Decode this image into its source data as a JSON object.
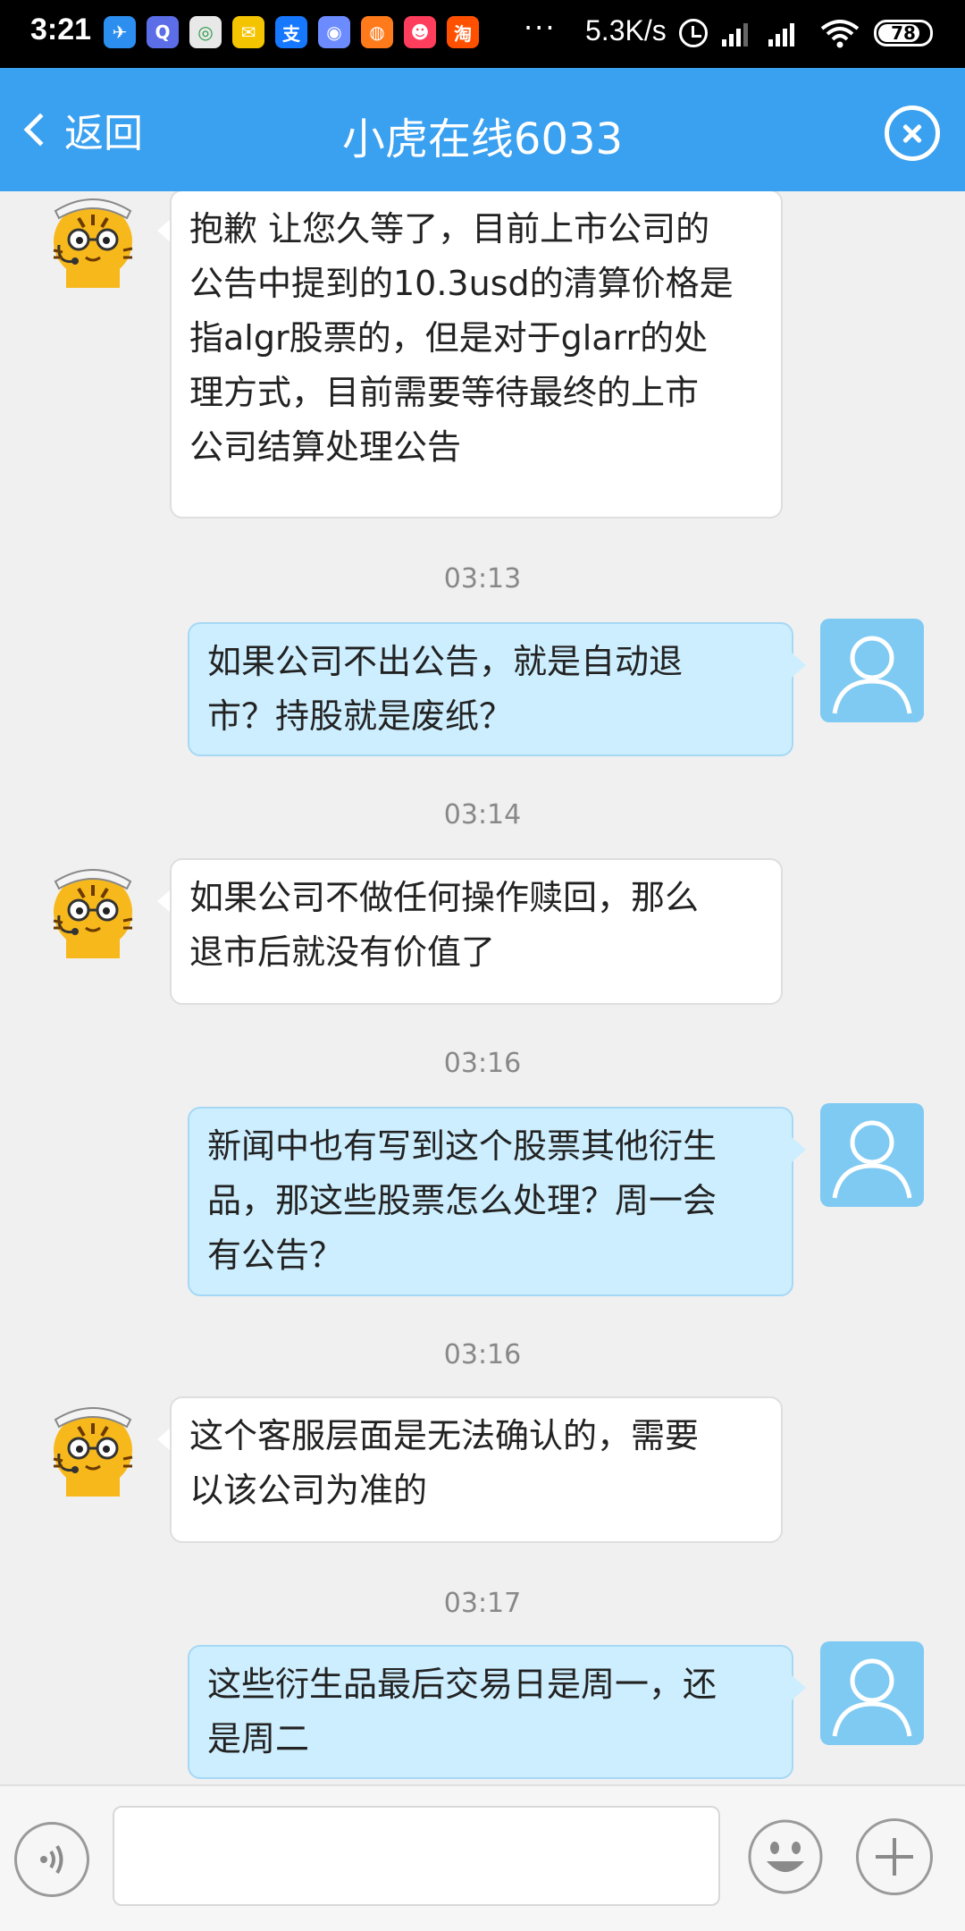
{
  "status_bar": {
    "time": "3:21",
    "network_speed": "5.3K/s",
    "battery": "78",
    "dots": "···",
    "app_icons": [
      {
        "name": "telegram-app-icon",
        "glyph": "✈",
        "color": "#2c8ff0"
      },
      {
        "name": "browser-app-icon",
        "glyph": "Q",
        "color": "#5b6ee8"
      },
      {
        "name": "chrome-app-icon",
        "glyph": "◎",
        "color": "#e8e8e8"
      },
      {
        "name": "mail-app-icon",
        "glyph": "✉",
        "color": "#f5c400"
      },
      {
        "name": "alipay-app-icon",
        "glyph": "支",
        "color": "#1677ff"
      },
      {
        "name": "chat-app-icon",
        "glyph": "◉",
        "color": "#6b8bff"
      },
      {
        "name": "weibo-app-icon",
        "glyph": "◍",
        "color": "#ff7a1a"
      },
      {
        "name": "pinduoduo-app-icon",
        "glyph": "☻",
        "color": "#ff3d5c"
      },
      {
        "name": "taobao-app-icon",
        "glyph": "淘",
        "color": "#ff5000"
      }
    ]
  },
  "header": {
    "back_label": "返回",
    "title": "小虎在线6033"
  },
  "messages": [
    {
      "id": "m1",
      "text": "抱歉 让您久等了，目前上市公司的\n公告中提到的10.3usd的清算价格是\n指algr股票的，但是对于glarr的处\n理方式，目前需要等待最终的上市\n公司结算处理公告"
    },
    {
      "id": "t1",
      "text": "03:13"
    },
    {
      "id": "m2",
      "text": "如果公司不出公告，就是自动退\n市？持股就是废纸？"
    },
    {
      "id": "t2",
      "text": "03:14"
    },
    {
      "id": "m3",
      "text": "如果公司不做任何操作赎回，那么\n退市后就没有价值了"
    },
    {
      "id": "t3",
      "text": "03:16"
    },
    {
      "id": "m4",
      "text": "新闻中也有写到这个股票其他衍生\n品，那这些股票怎么处理？周一会\n有公告？"
    },
    {
      "id": "t4",
      "text": "03:16"
    },
    {
      "id": "m5",
      "text": "这个客服层面是无法确认的，需要\n以该公司为准的"
    },
    {
      "id": "t5",
      "text": "03:17"
    },
    {
      "id": "m6",
      "text": "这些衍生品最后交易日是周一，还\n是周二"
    }
  ],
  "input": {
    "value": "",
    "placeholder": ""
  },
  "colors": {
    "header_blue": "#3aa0f0",
    "user_bubble": "#cdeefe",
    "agent_bubble": "#ffffff",
    "background": "#f0f0f0"
  }
}
